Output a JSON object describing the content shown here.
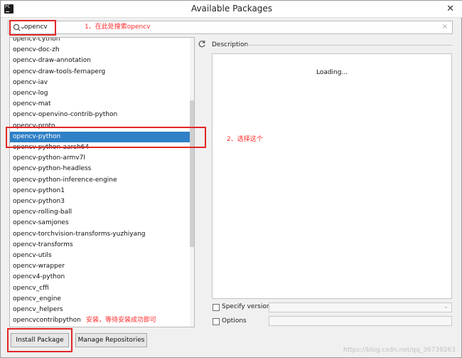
{
  "window": {
    "title": "Available Packages",
    "app_icon_text": "PC",
    "close_glyph": "✕"
  },
  "search": {
    "value": "opencv",
    "clear_glyph": "×"
  },
  "packages": [
    "opencv-cython",
    "opencv-doc-zh",
    "opencv-draw-annotation",
    "opencv-draw-tools-fernaperg",
    "opencv-iav",
    "opencv-log",
    "opencv-mat",
    "opencv-openvino-contrib-python",
    "opencv-proto",
    "opencv-python",
    "opencv-python-aarch64",
    "opencv-python-armv7l",
    "opencv-python-headless",
    "opencv-python-inference-engine",
    "opencv-python1",
    "opencv-python3",
    "opencv-rolling-ball",
    "opencv-samjones",
    "opencv-torchvision-transforms-yuzhiyang",
    "opencv-transforms",
    "opencv-utils",
    "opencv-wrapper",
    "opencv4-python",
    "opencv_cffi",
    "opencv_engine",
    "opencv_helpers",
    "opencvcontribpython"
  ],
  "selected_package": "opencv-python",
  "description": {
    "label": "Description",
    "loading_text": "Loading..."
  },
  "options": {
    "specify_version_label": "Specify version",
    "options_label": "Options",
    "version_chevron": "⌄"
  },
  "buttons": {
    "install_label": "Install Package",
    "manage_label": "Manage Repositories"
  },
  "annotations": {
    "step1": "1、在此处搜索opencv",
    "step2": "2、选择这个",
    "step3": "安装，等待安装成功即可"
  },
  "watermark": "https://blog.csdn.net/qq_36739263",
  "colors": {
    "selection": "#2f80c7",
    "annotation_red": "#e22626"
  }
}
